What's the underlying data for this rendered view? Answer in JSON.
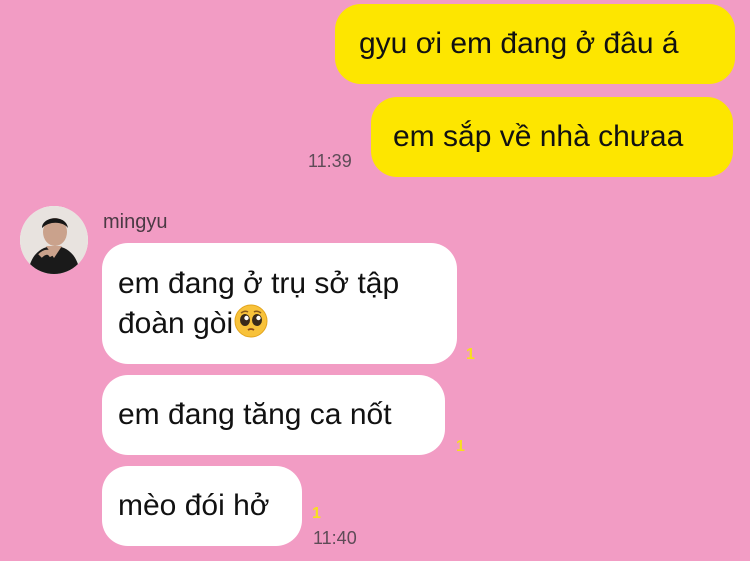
{
  "conversation": {
    "messages": [
      {
        "text": "gyu ơi em đang ở đâu á"
      },
      {
        "text": "em sắp về nhà chưaa"
      },
      {
        "text_line1": "em đang ở trụ sở tập",
        "text_line2": "đoàn gòi",
        "emoji": "pleading-face"
      },
      {
        "text": "em đang tăng ca nốt"
      },
      {
        "text": "mèo đói hở"
      }
    ],
    "outgoing_time": "11:39",
    "incoming_time": "11:40",
    "unread_marker": "1",
    "contact": {
      "name": "mingyu"
    }
  },
  "colors": {
    "background": "#f29cc4",
    "outgoing_bubble": "#fde600",
    "incoming_bubble": "#ffffff",
    "unread": "#f7df1e"
  }
}
